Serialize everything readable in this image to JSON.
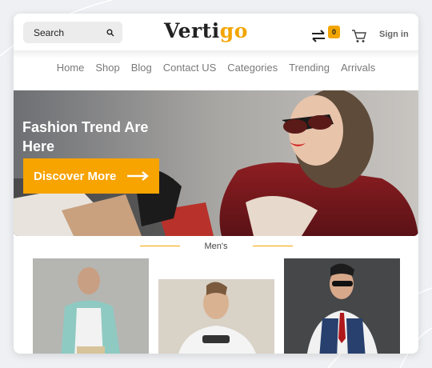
{
  "search": {
    "label": "Search"
  },
  "logo": {
    "part1": "Verti",
    "part2": "go"
  },
  "header": {
    "compare_count": "0",
    "signin_label": "Sign in"
  },
  "nav": {
    "items": [
      "Home",
      "Shop",
      "Blog",
      "Contact US",
      "Categories",
      "Trending",
      "Arrivals"
    ]
  },
  "hero": {
    "title": "Fashion Trend Are Here",
    "button_label": "Discover More"
  },
  "section": {
    "title": "Men's"
  },
  "colors": {
    "accent": "#f2a500",
    "button": "#f7a300"
  },
  "icons": [
    "search-icon",
    "transfer-icon",
    "cart-icon",
    "arrow-right-icon"
  ]
}
